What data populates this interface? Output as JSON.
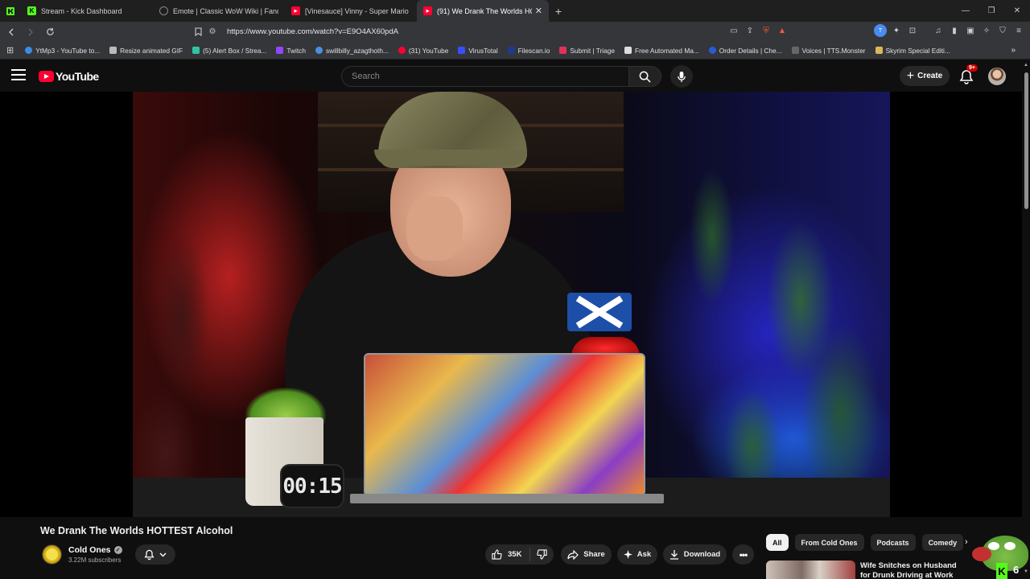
{
  "browser": {
    "tabs": [
      {
        "title": "Stream - Kick Dashboard",
        "favicon_color": "#53fc18",
        "favicon_glyph": "K",
        "active": false
      },
      {
        "title": "Emote | Classic WoW Wiki | Fandom",
        "favicon_color": "#888888",
        "favicon_glyph": "◎",
        "active": false
      },
      {
        "title": "[Vinesauce] Vinny - Super Mario Wo",
        "favicon_color": "#ff0033",
        "favicon_glyph": "▶",
        "active": false
      },
      {
        "title": "(91) We Drank The Worlds HO",
        "favicon_color": "#ff0033",
        "favicon_glyph": "▶",
        "active": true
      }
    ],
    "new_tab_label": "+",
    "url": "https://www.youtube.com/watch?v=E9O4AX60pdA",
    "bookmarks": [
      {
        "label": "YtMp3 - YouTube to...",
        "color": "#3a8ee6"
      },
      {
        "label": "Resize animated GIF",
        "color": "#bbbbbb"
      },
      {
        "label": "(5) Alert Box / Strea...",
        "color": "#31c3a2"
      },
      {
        "label": "Twitch",
        "color": "#9146ff"
      },
      {
        "label": "swillbilly_azagthoth...",
        "color": "#4a90e2"
      },
      {
        "label": "(31) YouTube",
        "color": "#ff0033"
      },
      {
        "label": "VirusTotal",
        "color": "#394eff"
      },
      {
        "label": "Filescan.io",
        "color": "#1e3a8a"
      },
      {
        "label": "Submit | Triage",
        "color": "#e0335b"
      },
      {
        "label": "Free Automated Ma...",
        "color": "#dddddd"
      },
      {
        "label": "Order Details | Che...",
        "color": "#2a5bd7"
      },
      {
        "label": "Voices | TTS.Monster",
        "color": "#666666"
      },
      {
        "label": "Skyrim Special Editi...",
        "color": "#d9b85a"
      }
    ]
  },
  "youtube": {
    "logo_text": "YouTube",
    "search_placeholder": "Search",
    "create_label": "Create",
    "notification_count": "9+",
    "video": {
      "timer_display": "00:15",
      "title": "We Drank The Worlds HOTTEST Alcohol",
      "channel": "Cold Ones",
      "subscribers": "3.22M subscribers",
      "likes": "35K",
      "share_label": "Share",
      "ask_label": "Ask",
      "download_label": "Download"
    },
    "chips": [
      "All",
      "From Cold Ones",
      "Podcasts",
      "Comedy"
    ],
    "recommendation": {
      "title": "Wife Snitches on Husband for Drunk Driving at Work"
    },
    "overlay_count": "6"
  }
}
